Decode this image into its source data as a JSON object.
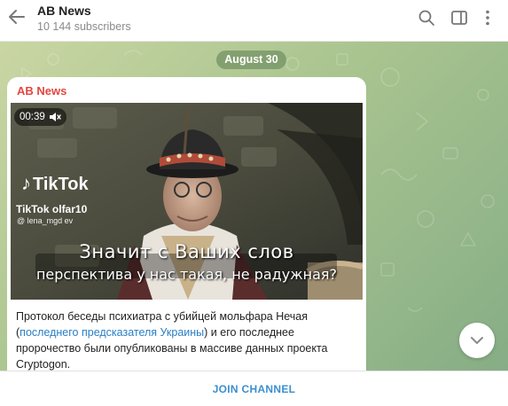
{
  "header": {
    "title": "AB News",
    "subscribers": "10 144 subscribers"
  },
  "chat": {
    "date_label": "August 30",
    "message": {
      "sender": "AB News",
      "video": {
        "duration": "00:39",
        "watermark_brand": "TikTok",
        "watermark_user_1": "TikTok olfar10",
        "watermark_user_2": "@ lena_mgd ev",
        "subtitle_line_1": "Значит с Ваших слов",
        "subtitle_line_2": "перспектива у нас такая, не радужная?"
      },
      "text_part_1": "Протокол беседы психиатра с убийцей мольфара Нечая (",
      "link_text": "последнего предсказателя Украины",
      "text_part_2": ") и его последнее пророчество были опубликованы в массиве данных проекта Cryptogon."
    }
  },
  "footer": {
    "join_label": "JOIN CHANNEL"
  }
}
